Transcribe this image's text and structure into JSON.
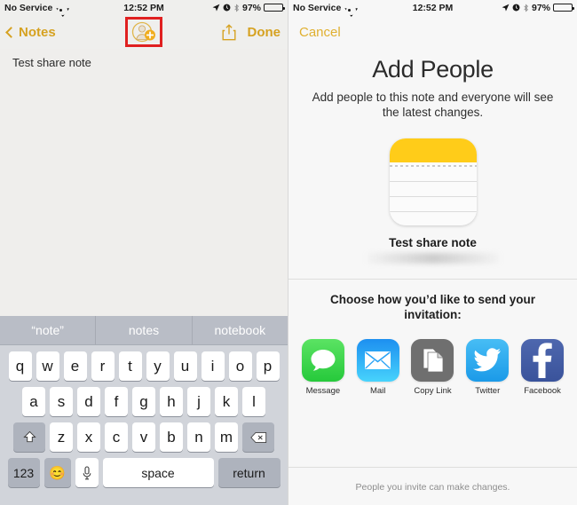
{
  "status_bar": {
    "carrier": "No Service",
    "wifi_icon": "wifi-icon",
    "time": "12:52 PM",
    "location_icon": "location-arrow-icon",
    "alarm_icon": "alarm-clock-icon",
    "bluetooth_icon": "bluetooth-icon",
    "battery_percent": "97%",
    "battery_icon": "battery-icon"
  },
  "left_screen": {
    "nav": {
      "back_label": "Notes",
      "back_icon": "chevron-left-icon",
      "add_people_icon": "add-person-icon",
      "share_icon": "share-export-icon",
      "done_label": "Done",
      "highlight_color": "#e02020"
    },
    "note": {
      "text": "Test share note"
    },
    "fab_icon": "plus-icon",
    "keyboard": {
      "suggestions": [
        "“note”",
        "notes",
        "notebook"
      ],
      "row1": [
        "q",
        "w",
        "e",
        "r",
        "t",
        "y",
        "u",
        "i",
        "o",
        "p"
      ],
      "row2": [
        "a",
        "s",
        "d",
        "f",
        "g",
        "h",
        "j",
        "k",
        "l"
      ],
      "row3": [
        "z",
        "x",
        "c",
        "v",
        "b",
        "n",
        "m"
      ],
      "shift_icon": "shift-icon",
      "delete_icon": "backspace-icon",
      "numbers_label": "123",
      "emoji_icon": "emoji-smiley-icon",
      "mic_icon": "microphone-icon",
      "space_label": "space",
      "return_label": "return"
    }
  },
  "right_screen": {
    "nav": {
      "cancel_label": "Cancel"
    },
    "title": "Add People",
    "subtitle": "Add people to this note and everyone will see the latest changes.",
    "note_thumbnail": {
      "icon": "note-thumbnail-icon",
      "title": "Test share note",
      "accent_color": "#ffcc19"
    },
    "choose_text": "Choose how you’d like to send your invitation:",
    "share_options": [
      {
        "label": "Message",
        "icon": "imessage-bubble-icon",
        "color": "#33cb41"
      },
      {
        "label": "Mail",
        "icon": "mail-envelope-icon",
        "color": "#2aa3f5"
      },
      {
        "label": "Copy Link",
        "icon": "copy-pages-icon",
        "color": "#6f6f6f"
      },
      {
        "label": "Twitter",
        "icon": "twitter-bird-icon",
        "color": "#23a7ea"
      },
      {
        "label": "Facebook",
        "icon": "facebook-f-icon",
        "color": "#3a539b"
      }
    ],
    "footer_note": "People you invite can make changes."
  }
}
